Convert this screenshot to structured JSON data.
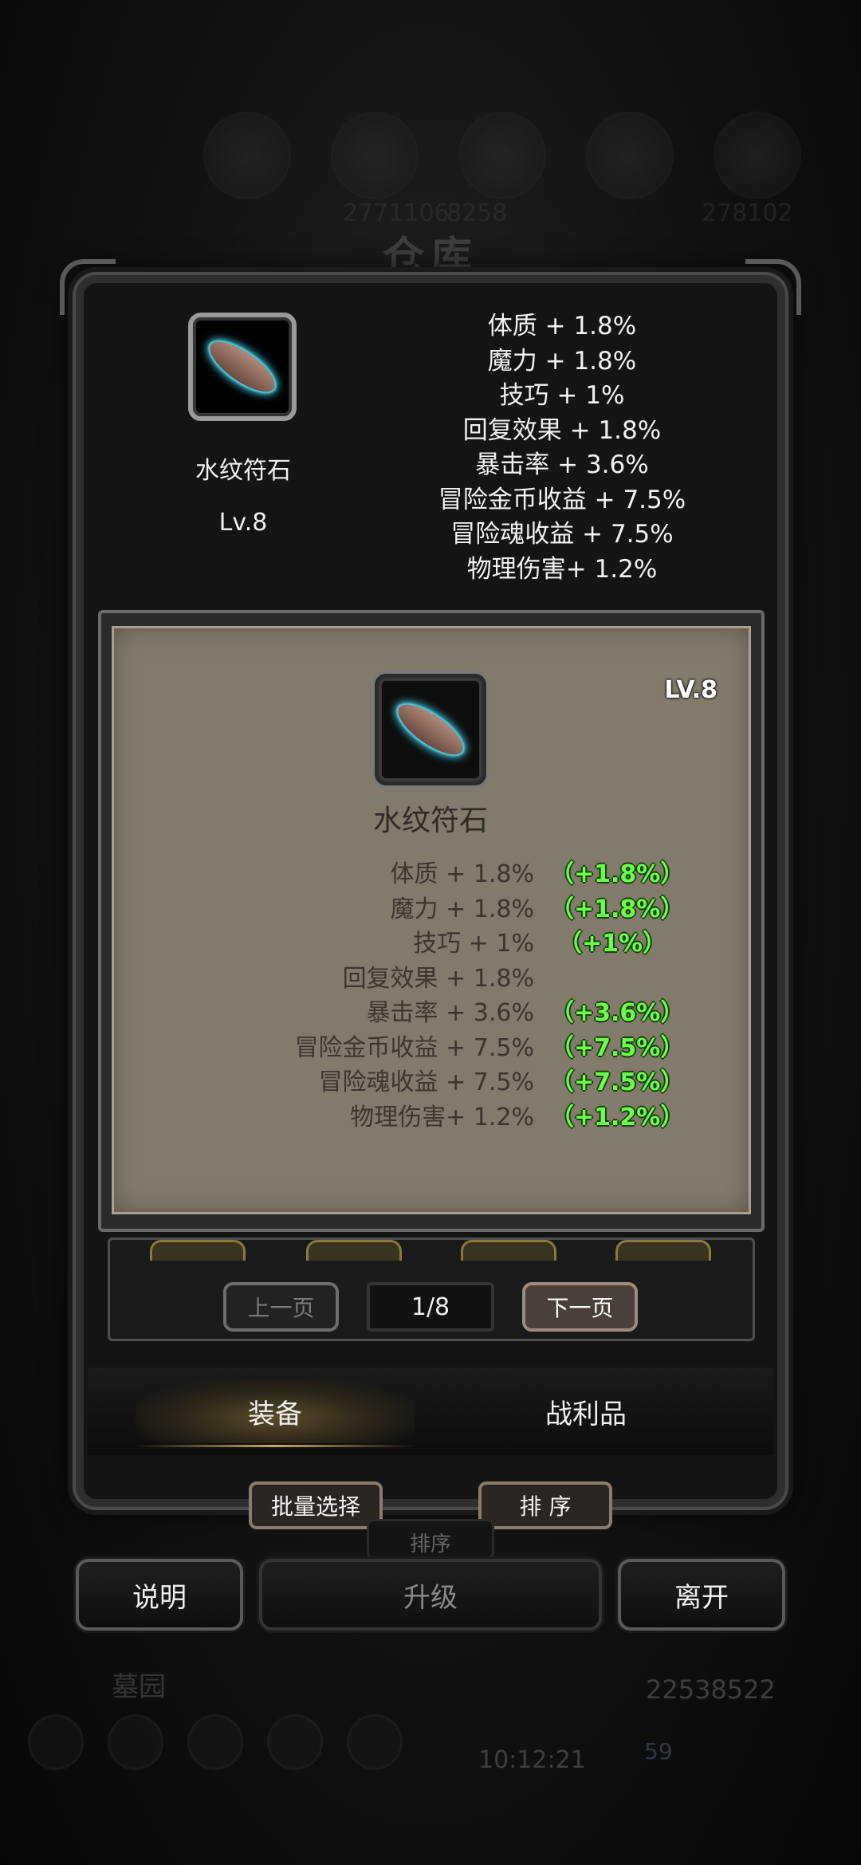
{
  "background": {
    "resource_numbers": [
      "2771106",
      "8258",
      "278102"
    ],
    "title": "仓库",
    "place": "墓园",
    "gold": "22538522",
    "time": "10:12:21",
    "gems": "59"
  },
  "item": {
    "name": "水纹符石",
    "level": "Lv.8",
    "panel_level": "LV.8",
    "icon": "water-rune-stone-icon",
    "stats": [
      "体质 + 1.8%",
      "魔力 + 1.8%",
      "技巧 + 1%",
      "回复效果 + 1.8%",
      "暴击率 + 3.6%",
      "冒险金币收益 + 7.5%",
      "冒险魂收益 + 7.5%",
      "物理伤害+ 1.2%"
    ],
    "bonuses": [
      "（+1.8%）",
      "（+1.8%）",
      "（+1%）",
      "",
      "（+3.6%）",
      "（+7.5%）",
      "（+7.5%）",
      "（+1.2%）"
    ]
  },
  "pagination": {
    "prev": "上一页",
    "page": "1/8",
    "next": "下一页"
  },
  "tabs": {
    "equipment": "装备",
    "loot": "战利品"
  },
  "actions": {
    "batch_select": "批量选择",
    "sort": "排 序",
    "sort_ghost": "排序",
    "info": "说明",
    "upgrade": "升级",
    "leave": "离开"
  },
  "colors": {
    "bonus_green": "#6bff4a",
    "panel_parchment": "#827b6b",
    "rune_glow": "#3ec7e0"
  }
}
